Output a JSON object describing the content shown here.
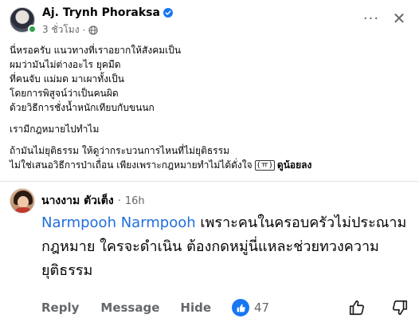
{
  "post": {
    "author": "Aj. Trynh Phoraksa",
    "timestamp": "3 ชั่วโมง",
    "more_label": "···",
    "close_label": "✕",
    "lines": [
      "นี่หรอครับ แนวทางที่เราอยากให้สังคมเป็น",
      "ผมว่ามันไม่ต่างอะไร ยุคมืด",
      "ที่คนจับ แม่มด มาเผาทั้งเป็น",
      "โดยการพิสูจน์ว่าเป็นคนผิด",
      "ด้วยวิธีการชั่งน้ำหนักเทียบกับขนนก",
      "เรามีกฎหมายไปทำไม",
      "ถ้ามันไม่ยุติธรรม ให้ดูว่ากระบวนการไหนที่ไม่ยุติธรรม"
    ],
    "last_line": "ไม่ใช่เสนอวิธีการป่าเถื่อน เพียงเพราะกฎหมายทำไม่ได้ดั่งใจ",
    "kaomoji": "(ㅠ)",
    "see_more": "ดูน้อยลง"
  },
  "comment": {
    "author": "นางงาม ตัวเต็ง",
    "dot": "·",
    "time": "16h",
    "mention": "Narmpooh Narmpooh",
    "text": " เพราะคนในครอบครัวไม่ประณาม กฎหมาย ใครจะดำเนิน ต้องกดหมู่นี่แหละช่วยทวงความยุติธรรม",
    "actions": {
      "reply": "Reply",
      "message": "Message",
      "hide": "Hide"
    },
    "reaction_count": "47"
  },
  "colors": {
    "accent": "#1877f2",
    "mention": "#216fdb",
    "muted": "#65676b",
    "online": "#31a24c"
  },
  "icons": {
    "verified": "verified-badge-icon",
    "globe": "globe-icon",
    "like_reaction": "like-reaction-icon",
    "thumbs_up": "thumbs-up-icon",
    "thumbs_down": "thumbs-down-icon"
  }
}
